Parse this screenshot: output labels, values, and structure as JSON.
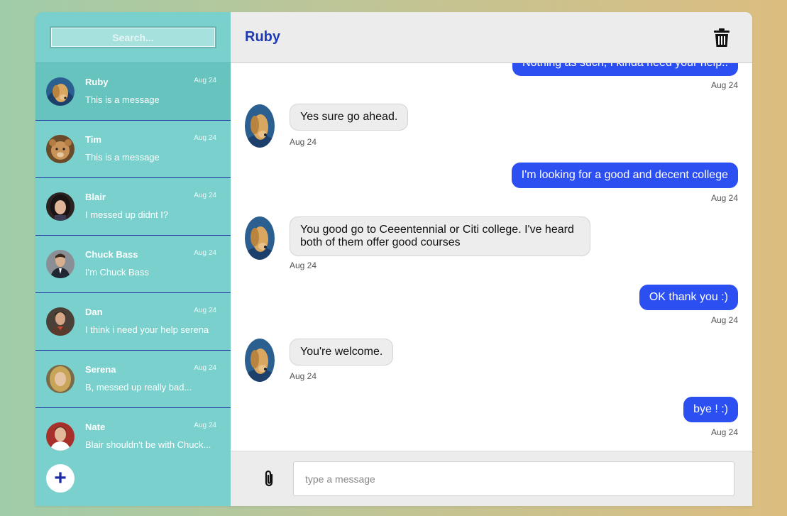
{
  "search": {
    "placeholder": "Search..."
  },
  "contacts": [
    {
      "name": "Ruby",
      "date": "Aug 24",
      "message": "This is a message",
      "avatar": "dog-avatar",
      "active": true
    },
    {
      "name": "Tim",
      "date": "Aug 24",
      "message": "This is a message",
      "avatar": "lion-cub-avatar"
    },
    {
      "name": "Blair",
      "date": "Aug 24",
      "message": "I messed up didnt I?",
      "avatar": "woman-avatar"
    },
    {
      "name": "Chuck Bass",
      "date": "Aug 24",
      "message": "I'm Chuck Bass",
      "avatar": "man-suit-avatar"
    },
    {
      "name": "Dan",
      "date": "Aug 24",
      "message": "I think i need your help serena",
      "avatar": "man-avatar"
    },
    {
      "name": "Serena",
      "date": "Aug 24",
      "message": "B, messed up really bad...",
      "avatar": "blonde-woman-avatar"
    },
    {
      "name": "Nate",
      "date": "Aug 24",
      "message": "Blair shouldn't be with Chuck...",
      "avatar": "man-avatar"
    }
  ],
  "sidebar_footer": {
    "add_label": "+"
  },
  "chat": {
    "title": "Ruby",
    "messages": [
      {
        "direction": "out",
        "text": "Nothing as such, I kinda need your help..",
        "date": "Aug 24"
      },
      {
        "direction": "in",
        "text": "Yes sure go ahead.",
        "date": "Aug 24"
      },
      {
        "direction": "out",
        "text": "I'm looking for a good and decent college",
        "date": "Aug 24"
      },
      {
        "direction": "in",
        "text": "You good go to Ceeentennial or Citi college. I've heard both of them offer good courses",
        "date": "Aug 24"
      },
      {
        "direction": "out",
        "text": "OK thank you :)",
        "date": "Aug 24"
      },
      {
        "direction": "in",
        "text": "You're welcome.",
        "date": "Aug 24"
      },
      {
        "direction": "out",
        "text": "bye ! :)",
        "date": "Aug 24"
      }
    ]
  },
  "composer": {
    "placeholder": "type a message"
  },
  "colors": {
    "sidebar": "#79d0cc",
    "accent": "#2b4ff0",
    "title": "#1f3ab5"
  }
}
